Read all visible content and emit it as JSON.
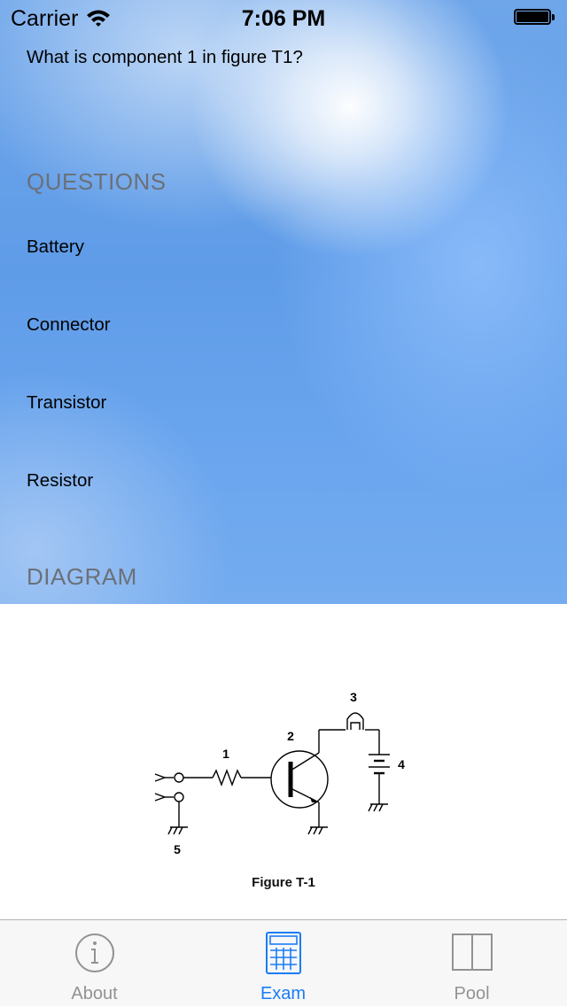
{
  "status_bar": {
    "carrier": "Carrier",
    "time": "7:06 PM"
  },
  "question": {
    "text": "What is component 1 in figure T1?"
  },
  "questions_section": {
    "header": "QUESTIONS",
    "answers": [
      {
        "label": "Battery"
      },
      {
        "label": "Connector"
      },
      {
        "label": "Transistor"
      },
      {
        "label": "Resistor"
      }
    ]
  },
  "diagram_section": {
    "header": "DIAGRAM",
    "figure": {
      "caption": "Figure T-1",
      "labels": [
        "1",
        "2",
        "3",
        "4",
        "5"
      ]
    }
  },
  "tab_bar": {
    "active": "Exam",
    "accent_color": "#1a7cf5",
    "inactive_color": "#929292",
    "tabs": [
      {
        "label": "About",
        "icon": "info-icon"
      },
      {
        "label": "Exam",
        "icon": "calculator-icon"
      },
      {
        "label": "Pool",
        "icon": "book-icon"
      }
    ]
  }
}
